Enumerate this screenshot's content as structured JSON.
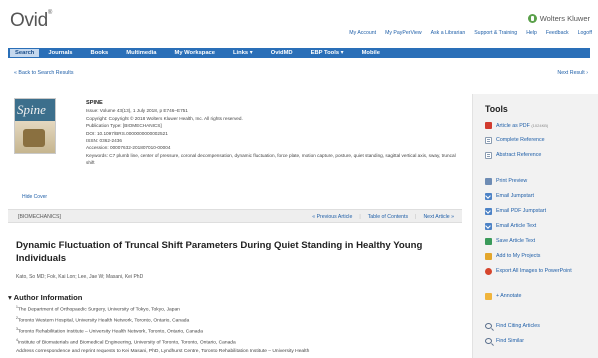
{
  "header": {
    "logo": "Ovid",
    "logo_mark": "®",
    "brand": "Wolters Kluwer",
    "top_links": [
      "My Account",
      "My PayPerView",
      "Ask a Librarian",
      "Support & Training",
      "Help",
      "Feedback",
      "Logoff"
    ]
  },
  "nav": {
    "items": [
      "Search",
      "Journals",
      "Books",
      "Multimedia",
      "My Workspace",
      "Links ▾",
      "OvidMD",
      "EBP Tools ▾",
      "Mobile"
    ]
  },
  "links": {
    "back": "« Back to Search Results",
    "next": "Next Result ›",
    "hide_cover": "Hide Cover"
  },
  "cover": {
    "title": "Spine"
  },
  "article": {
    "journal": "SPINE",
    "issue": "Issue: Volume 43(13), 1 July 2018, p E746–E751",
    "copyright": "Copyright: Copyright © 2018 Wolters Kluwer Health, Inc. All rights reserved.",
    "pubtype": "Publication Type: [BIOMECHANICS]",
    "doi": "DOI: 10.1097/BRS.0000000000002521",
    "issn": "ISSN: 0362-2436",
    "accession": "Accession: 00007632-201807010-00004",
    "keywords": "Keywords: C7 plumb line, center of pressure, coronal decompensation, dynamic fluctuation, force plate, motion capture, posture, quiet standing, sagittal vertical axis, sway, truncal shift"
  },
  "bar": {
    "category": "[BIOMECHANICS]",
    "prev": "« Previous Article",
    "toc": "Table of Contents",
    "next": "Next Article »"
  },
  "title": "Dynamic Fluctuation of Truncal Shift Parameters During Quiet Standing in Healthy Young Individuals",
  "authors": "Kato, So MD; Fok, Kai Lon; Lee, Jae W; Masani, Kei PhD",
  "author_info": {
    "heading": "Author Information",
    "affiliations": [
      "The Department of Orthopaedic Surgery, University of Tokyo, Tokyo, Japan",
      "Toronto Western Hospital, University Health Network, Toronto, Ontario, Canada",
      "Toronto Rehabilitation Institute – University Health Network, Toronto, Ontario, Canada",
      "Institute of Biomaterials and Biomedical Engineering, University of Toronto, Toronto, Ontario, Canada",
      "Address correspondence and reprint requests to Kei Masani, PhD, Lyndhurst Centre, Toronto Rehabilitation Institute – University Health"
    ]
  },
  "tools": {
    "heading": "Tools",
    "items": [
      "Article as PDF",
      "Complete Reference",
      "Abstract Reference",
      "Print Preview",
      "Email Jumpstart",
      "Email PDF Jumpstart",
      "Email Article Text",
      "Save Article Text",
      "Add to My Projects",
      "Export All Images to PowerPoint",
      "+ Annotate",
      "Find Citing Articles",
      "Find Similar"
    ],
    "pdf_size": "(1024KB)"
  }
}
